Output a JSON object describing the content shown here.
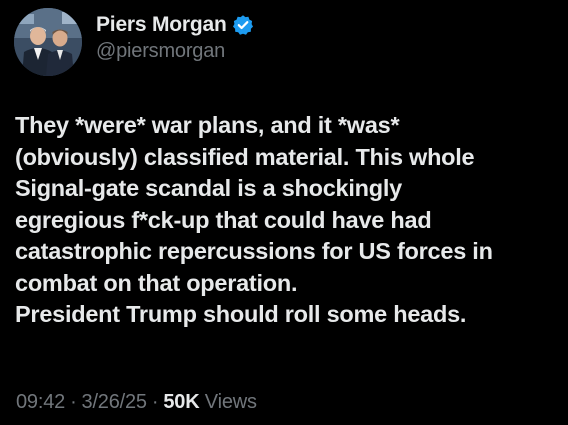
{
  "author": {
    "display_name": "Piers Morgan",
    "handle": "@piersmorgan",
    "verified": true,
    "verified_icon": "verified-badge-icon",
    "verified_color": "#1d9bf0"
  },
  "post": {
    "text_lines": [
      "They *were* war plans, and it *was*",
      "(obviously) classified material. This whole",
      "Signal-gate scandal is a shockingly",
      "egregious f*ck-up that could have had",
      "catastrophic repercussions for US forces in",
      "combat on that operation.",
      "President Trump should roll some heads."
    ]
  },
  "meta": {
    "time": "09:42",
    "separator": "·",
    "date": "3/26/25",
    "views_count": "50K",
    "views_label": "Views"
  },
  "colors": {
    "background": "#000000",
    "primary_text": "#e7e9ea",
    "secondary_text": "#71767b"
  }
}
